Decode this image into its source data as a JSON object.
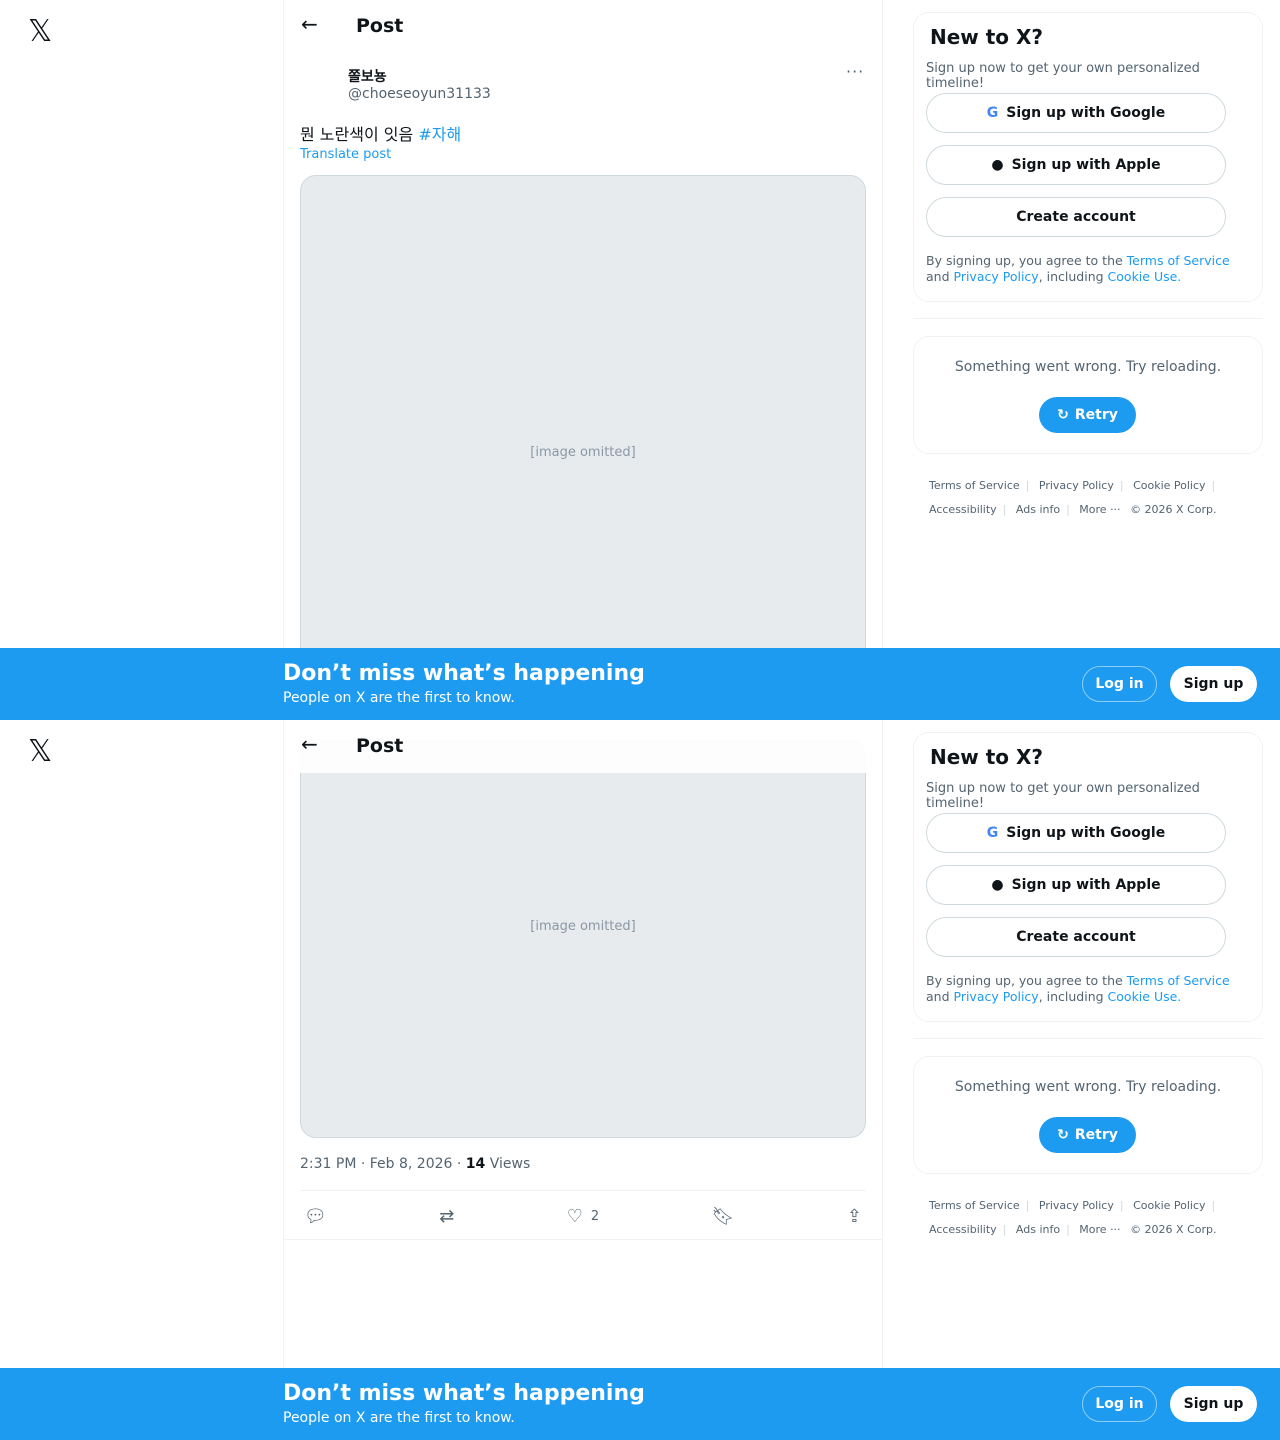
{
  "nav": {
    "logo": "𝕏"
  },
  "header": {
    "back": "←",
    "title": "Post"
  },
  "post": {
    "author_name": "쫄보뇽",
    "author_handle": "@choeseoyun31133",
    "more": "···",
    "text": "뭔 노란색이 잇음 ",
    "hashtag": "#자해",
    "translate": "Translate post",
    "time": "2:31 PM · Feb 8, 2026 · ",
    "views_count": "14",
    "views_label": " Views",
    "likes": "2"
  },
  "signup": {
    "title": "New to X?",
    "subtitle": "Sign up now to get your own personalized timeline!",
    "google": "Sign up with Google",
    "apple": "Sign up with Apple",
    "create": "Create account",
    "legal_prefix": "By signing up, you agree to the ",
    "terms": "Terms of Service",
    "and": " and ",
    "privacy": "Privacy Policy",
    "including": ", including ",
    "cookie": "Cookie Use."
  },
  "error": {
    "text": "Something went wrong. Try reloading.",
    "retry": "Retry"
  },
  "footer": {
    "items": [
      "Terms of Service",
      "Privacy Policy",
      "Cookie Policy",
      "Accessibility",
      "Ads info",
      "More ···",
      "© 2026 X Corp."
    ]
  },
  "banner": {
    "title": "Don’t miss what’s happening",
    "subtitle": "People on X are the first to know.",
    "login": "Log in",
    "signup": "Sign up"
  },
  "colors": {
    "accent": "#1d9bf0",
    "text": "#0f1419",
    "muted": "#536471"
  }
}
